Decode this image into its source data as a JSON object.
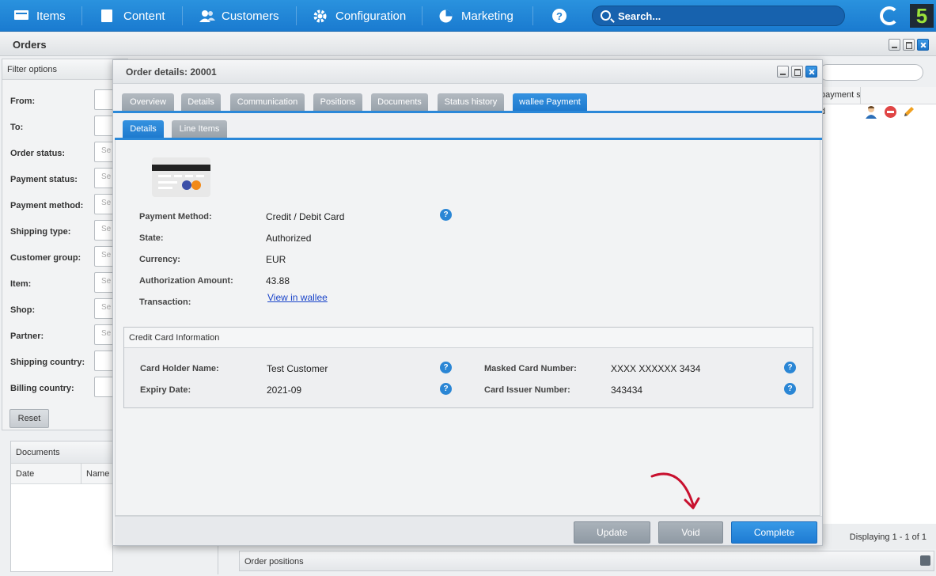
{
  "nav": {
    "items": [
      "Items",
      "Content",
      "Customers",
      "Configuration",
      "Marketing"
    ],
    "search_placeholder": "Search..."
  },
  "logo": {
    "text": "5"
  },
  "orders": {
    "title": "Orders",
    "filter_title": "Filter options",
    "filters": [
      "From:",
      "To:",
      "Order status:",
      "Payment status:",
      "Payment method:",
      "Shipping type:",
      "Customer group:",
      "Item:",
      "Shop:",
      "Partner:",
      "Shipping country:",
      "Billing country:"
    ],
    "select_hint": "Se",
    "reset_label": "Reset",
    "documents_title": "Documents",
    "documents_cols": [
      "Date",
      "Name"
    ],
    "list_col_partial": "payment s",
    "list_row_partial": "d",
    "displaying": "Displaying 1 - 1 of 1",
    "order_positions": "Order positions"
  },
  "modal": {
    "title": "Order details: 20001",
    "tabs": [
      "Overview",
      "Details",
      "Communication",
      "Positions",
      "Documents",
      "Status history",
      "wallee Payment"
    ],
    "subtabs": [
      "Details",
      "Line Items"
    ],
    "payment_method_label": "Payment Method:",
    "payment_method": "Credit / Debit Card",
    "state_label": "State:",
    "state": "Authorized",
    "currency_label": "Currency:",
    "currency": "EUR",
    "amount_label": "Authorization Amount:",
    "amount": "43.88",
    "transaction_label": "Transaction:",
    "transaction_link": "View in wallee",
    "cc_title": "Credit Card Information",
    "holder_label": "Card Holder Name:",
    "holder": "Test Customer",
    "expiry_label": "Expiry Date:",
    "expiry": "2021-09",
    "masked_label": "Masked Card Number:",
    "masked": "XXXX XXXXXX 3434",
    "issuer_label": "Card Issuer Number:",
    "issuer": "343434",
    "help": "?",
    "buttons": {
      "update": "Update",
      "void": "Void",
      "complete": "Complete"
    }
  },
  "colors": {
    "accent": "#2b88d8",
    "tab_inactive": "#a3abb3",
    "annotation": "#c8102e"
  }
}
